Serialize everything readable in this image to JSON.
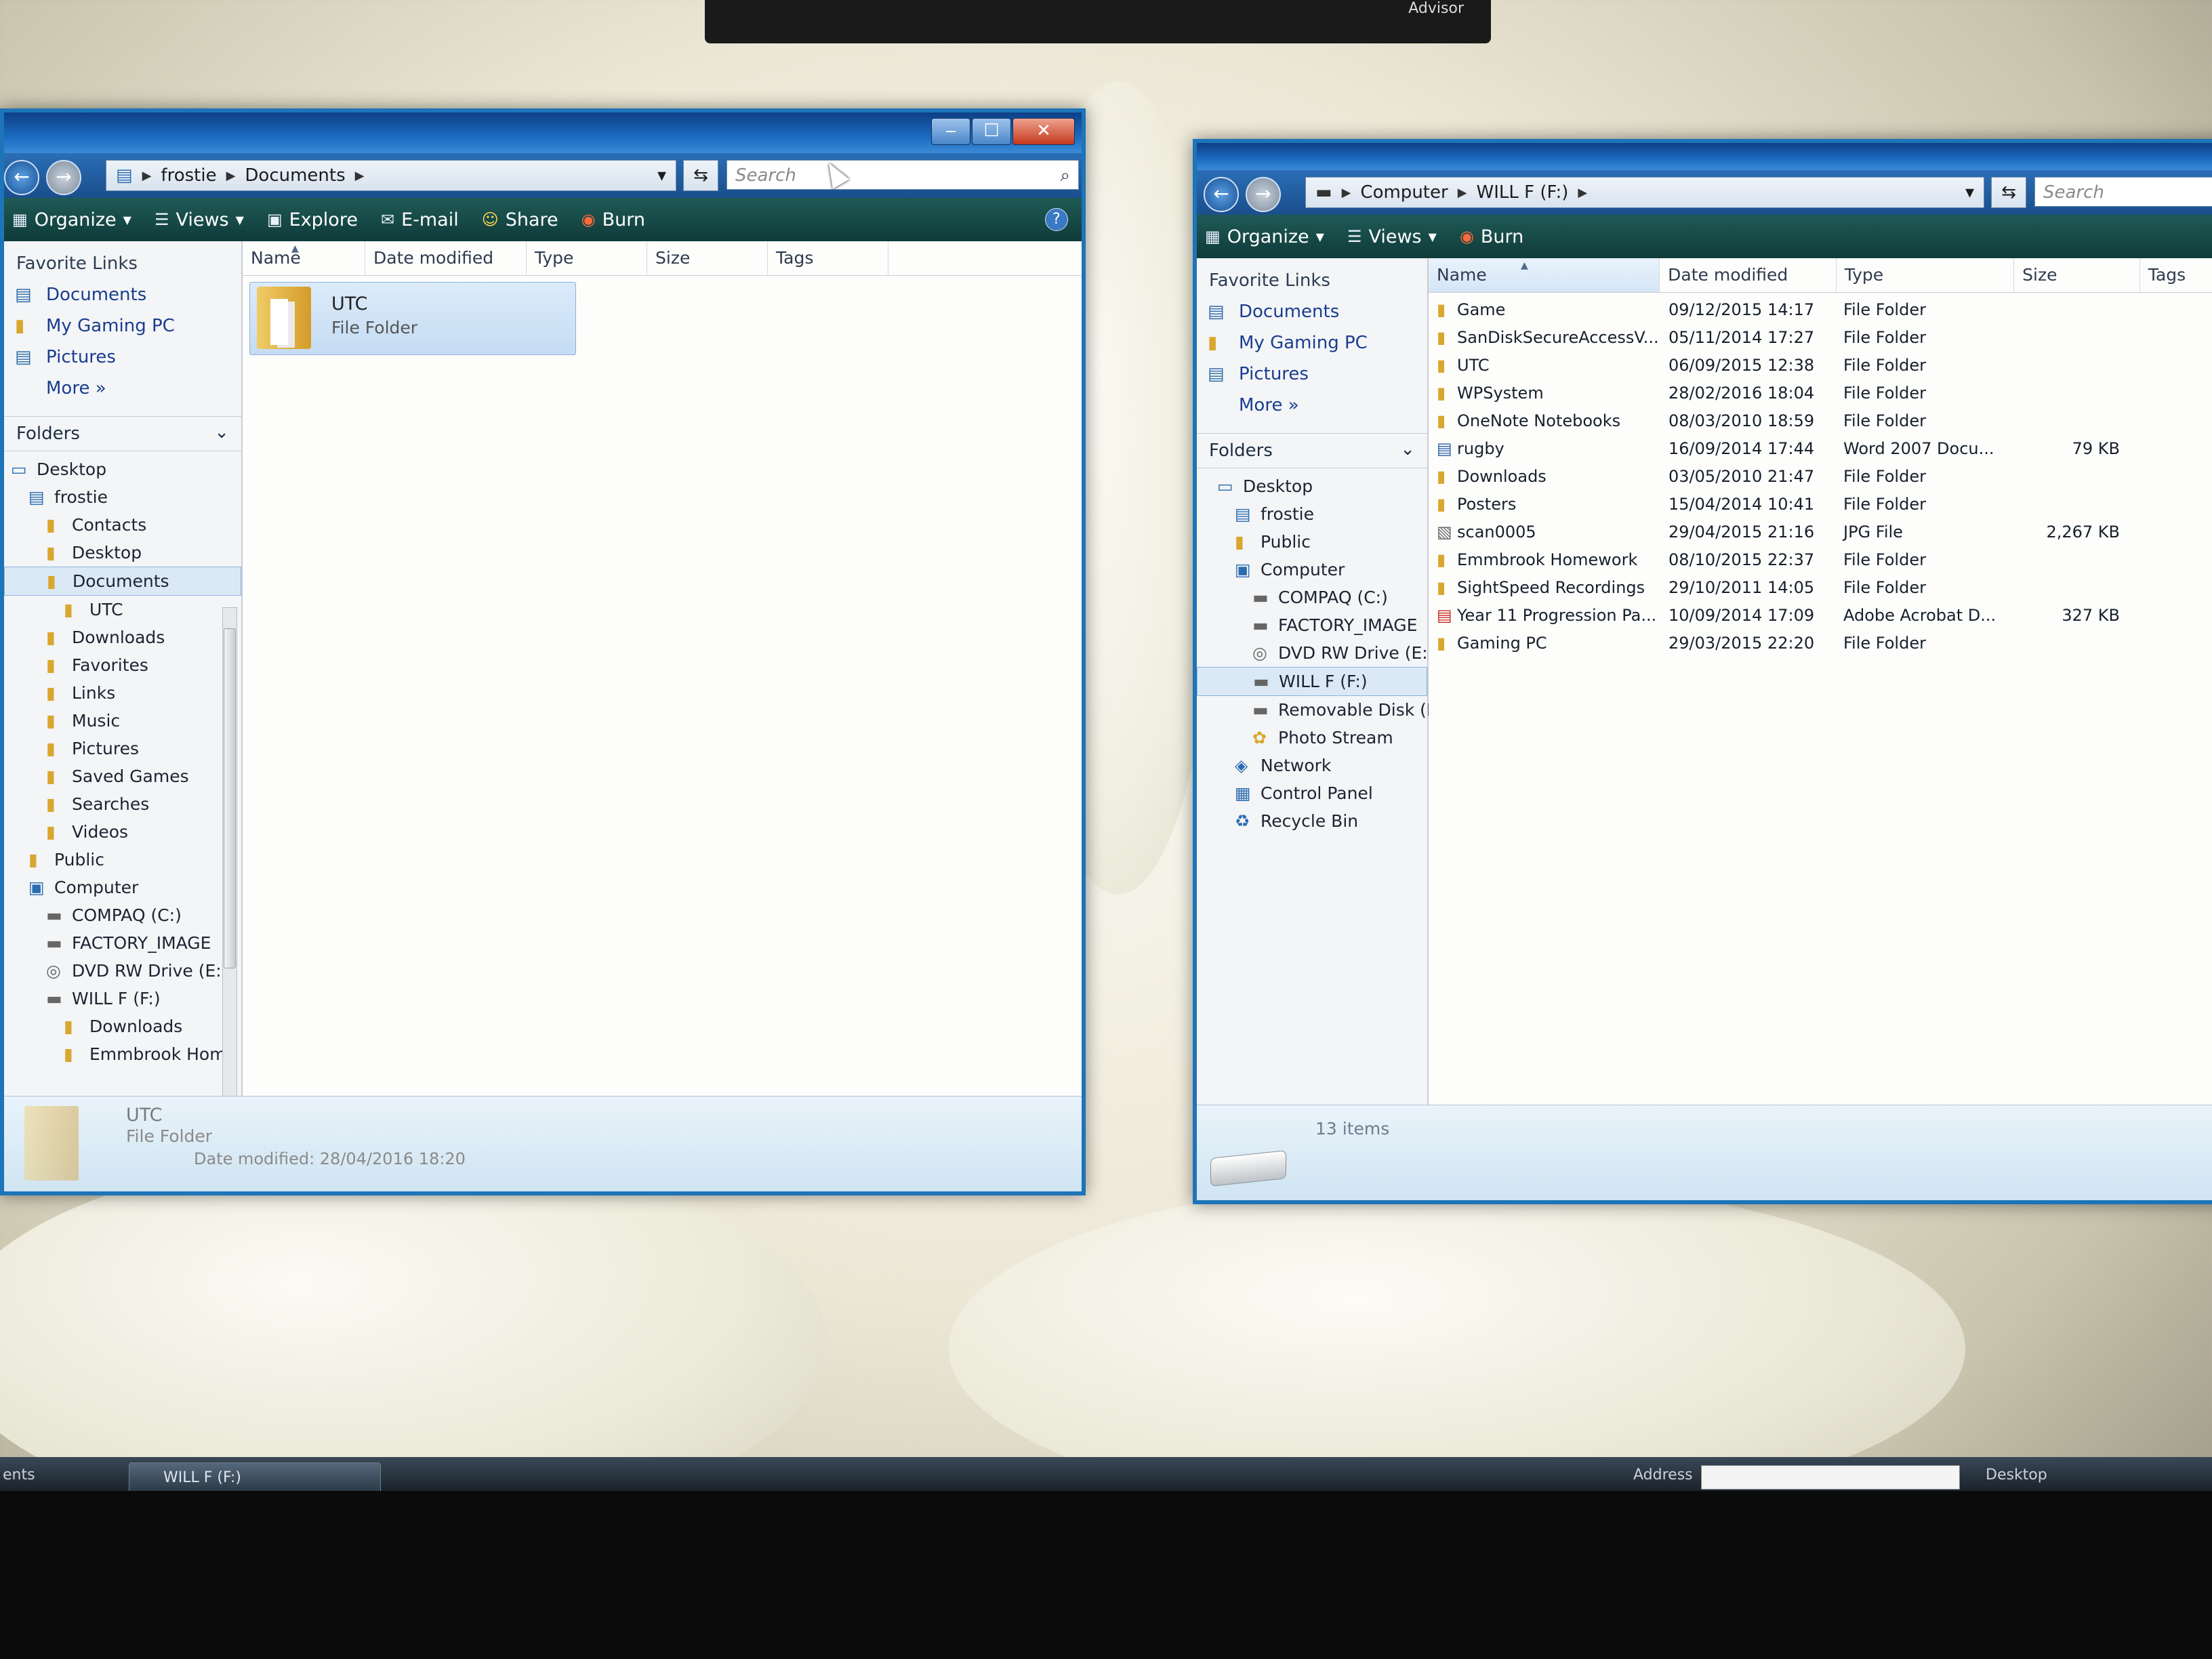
{
  "taskbar": {
    "left_label": "ents",
    "button_label": "WILL F (F:)",
    "address_label": "Address",
    "desktop_label": "Desktop"
  },
  "topbar": {
    "brand": "Advisor"
  },
  "left_window": {
    "breadcrumb": [
      "frostie",
      "Documents"
    ],
    "search_placeholder": "Search",
    "toolbar": {
      "organize": "Organize",
      "views": "Views",
      "explore": "Explore",
      "email": "E-mail",
      "share": "Share",
      "burn": "Burn"
    },
    "favorite_links_title": "Favorite Links",
    "favorite_links": [
      "Documents",
      "My Gaming PC",
      "Pictures"
    ],
    "more": "More",
    "folders_label": "Folders",
    "tree": [
      {
        "label": "Desktop",
        "depth": 0,
        "icon": "desktop-icon"
      },
      {
        "label": "frostie",
        "depth": 1,
        "icon": "user-icon"
      },
      {
        "label": "Contacts",
        "depth": 2,
        "icon": "folder-icon"
      },
      {
        "label": "Desktop",
        "depth": 2,
        "icon": "folder-icon"
      },
      {
        "label": "Documents",
        "depth": 2,
        "icon": "folder-icon",
        "selected": true
      },
      {
        "label": "UTC",
        "depth": 3,
        "icon": "folder-icon"
      },
      {
        "label": "Downloads",
        "depth": 2,
        "icon": "folder-icon"
      },
      {
        "label": "Favorites",
        "depth": 2,
        "icon": "folder-icon"
      },
      {
        "label": "Links",
        "depth": 2,
        "icon": "folder-icon"
      },
      {
        "label": "Music",
        "depth": 2,
        "icon": "folder-icon"
      },
      {
        "label": "Pictures",
        "depth": 2,
        "icon": "folder-icon"
      },
      {
        "label": "Saved Games",
        "depth": 2,
        "icon": "folder-icon"
      },
      {
        "label": "Searches",
        "depth": 2,
        "icon": "folder-icon"
      },
      {
        "label": "Videos",
        "depth": 2,
        "icon": "folder-icon"
      },
      {
        "label": "Public",
        "depth": 1,
        "icon": "folder-icon"
      },
      {
        "label": "Computer",
        "depth": 1,
        "icon": "computer-icon"
      },
      {
        "label": "COMPAQ (C:)",
        "depth": 2,
        "icon": "drive-icon"
      },
      {
        "label": "FACTORY_IMAGE",
        "depth": 2,
        "icon": "drive-icon"
      },
      {
        "label": "DVD RW Drive (E:)",
        "depth": 2,
        "icon": "dvd-icon"
      },
      {
        "label": "WILL F (F:)",
        "depth": 2,
        "icon": "usb-drive-icon"
      },
      {
        "label": "Downloads",
        "depth": 3,
        "icon": "folder-icon"
      },
      {
        "label": "Emmbrook Hom",
        "depth": 3,
        "icon": "folder-icon"
      }
    ],
    "columns": [
      "Name",
      "Date modified",
      "Type",
      "Size",
      "Tags"
    ],
    "item": {
      "name": "UTC",
      "type": "File Folder"
    },
    "details": {
      "name": "UTC",
      "type": "File Folder",
      "date": "Date modified: 28/04/2016 18:20"
    }
  },
  "right_window": {
    "breadcrumb": [
      "Computer",
      "WILL F (F:)"
    ],
    "search_placeholder": "Search",
    "toolbar": {
      "organize": "Organize",
      "views": "Views",
      "burn": "Burn"
    },
    "favorite_links_title": "Favorite Links",
    "favorite_links": [
      "Documents",
      "My Gaming PC",
      "Pictures"
    ],
    "more": "More",
    "folders_label": "Folders",
    "tree": [
      {
        "label": "Desktop",
        "depth": 0,
        "icon": "desktop-icon"
      },
      {
        "label": "frostie",
        "depth": 1,
        "icon": "user-icon"
      },
      {
        "label": "Public",
        "depth": 1,
        "icon": "folder-icon"
      },
      {
        "label": "Computer",
        "depth": 1,
        "icon": "computer-icon"
      },
      {
        "label": "COMPAQ (C:)",
        "depth": 2,
        "icon": "drive-icon"
      },
      {
        "label": "FACTORY_IMAGE",
        "depth": 2,
        "icon": "drive-icon"
      },
      {
        "label": "DVD RW Drive (E:)",
        "depth": 2,
        "icon": "dvd-icon"
      },
      {
        "label": "WILL F (F:)",
        "depth": 2,
        "icon": "usb-drive-icon",
        "selected": true
      },
      {
        "label": "Removable Disk (I",
        "depth": 2,
        "icon": "usb-drive-icon"
      },
      {
        "label": "Photo Stream",
        "depth": 2,
        "icon": "photo-icon"
      },
      {
        "label": "Network",
        "depth": 1,
        "icon": "network-icon"
      },
      {
        "label": "Control Panel",
        "depth": 1,
        "icon": "control-panel-icon"
      },
      {
        "label": "Recycle Bin",
        "depth": 1,
        "icon": "recycle-bin-icon"
      }
    ],
    "columns": [
      "Name",
      "Date modified",
      "Type",
      "Size",
      "Tags"
    ],
    "files": [
      {
        "name": "Game",
        "date": "09/12/2015 14:17",
        "type": "File Folder",
        "size": "",
        "icon": "folder"
      },
      {
        "name": "SanDiskSecureAccessV...",
        "date": "05/11/2014 17:27",
        "type": "File Folder",
        "size": "",
        "icon": "folder"
      },
      {
        "name": "UTC",
        "date": "06/09/2015 12:38",
        "type": "File Folder",
        "size": "",
        "icon": "folder"
      },
      {
        "name": "WPSystem",
        "date": "28/02/2016 18:04",
        "type": "File Folder",
        "size": "",
        "icon": "folder"
      },
      {
        "name": "OneNote Notebooks",
        "date": "08/03/2010 18:59",
        "type": "File Folder",
        "size": "",
        "icon": "folder"
      },
      {
        "name": "rugby",
        "date": "16/09/2014 17:44",
        "type": "Word 2007 Docu...",
        "size": "79 KB",
        "icon": "doc"
      },
      {
        "name": "Downloads",
        "date": "03/05/2010 21:47",
        "type": "File Folder",
        "size": "",
        "icon": "folder"
      },
      {
        "name": "Posters",
        "date": "15/04/2014 10:41",
        "type": "File Folder",
        "size": "",
        "icon": "folder"
      },
      {
        "name": "scan0005",
        "date": "29/04/2015 21:16",
        "type": "JPG File",
        "size": "2,267 KB",
        "icon": "jpg"
      },
      {
        "name": "Emmbrook Homework",
        "date": "08/10/2015 22:37",
        "type": "File Folder",
        "size": "",
        "icon": "folder"
      },
      {
        "name": "SightSpeed Recordings",
        "date": "29/10/2011 14:05",
        "type": "File Folder",
        "size": "",
        "icon": "folder"
      },
      {
        "name": "Year 11 Progression Pa...",
        "date": "10/09/2014 17:09",
        "type": "Adobe Acrobat D...",
        "size": "327 KB",
        "icon": "pdf"
      },
      {
        "name": "Gaming PC",
        "date": "29/03/2015 22:20",
        "type": "File Folder",
        "size": "",
        "icon": "folder"
      }
    ],
    "item_count": "13 items"
  }
}
